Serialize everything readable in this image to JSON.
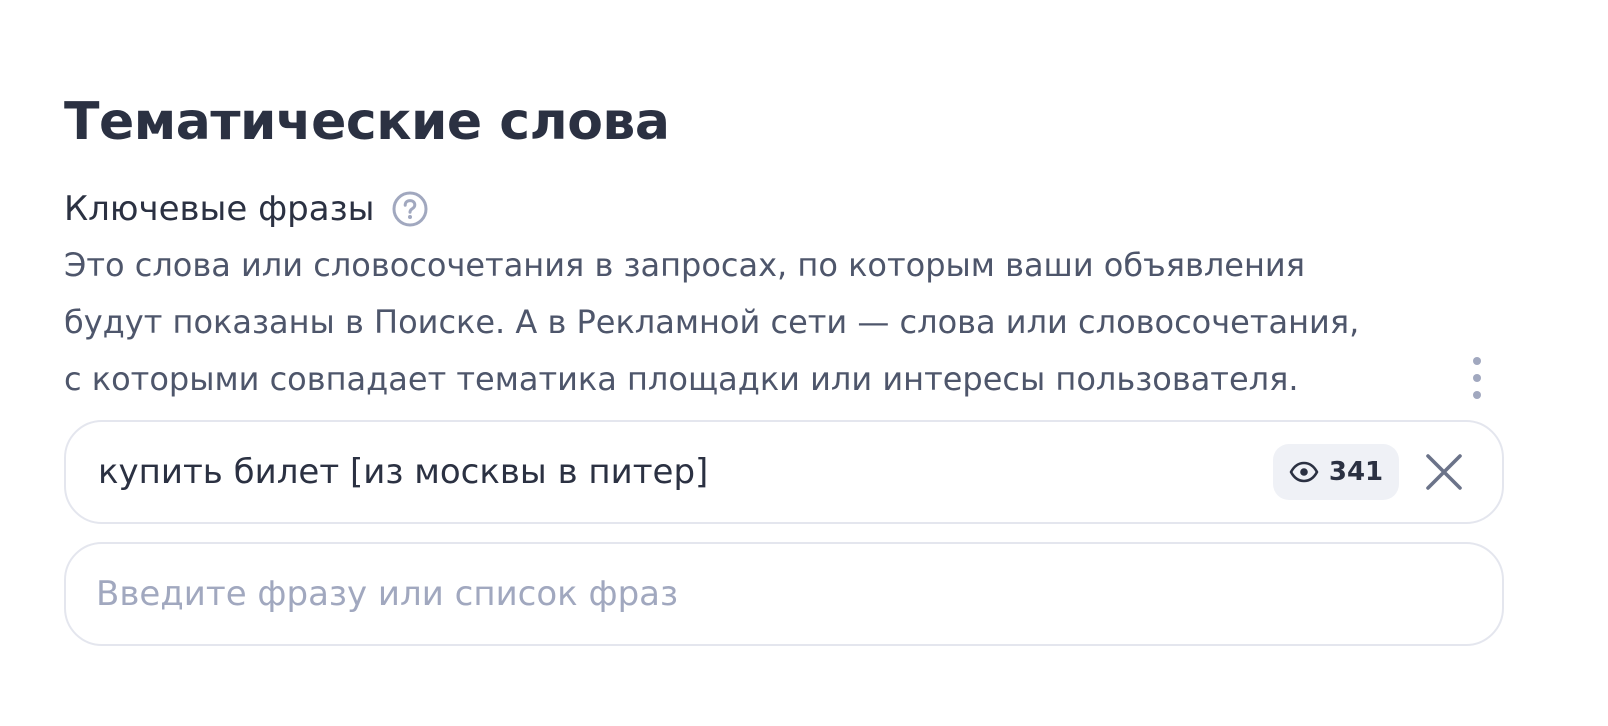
{
  "section": {
    "title": "Тематические слова"
  },
  "keywords": {
    "label": "Ключевые фразы",
    "help_icon": "question-circle-icon",
    "description_lines": [
      "Это слова или словосочетания в запросах, по которым ваши объявления",
      "будут показаны в Поиске. А в Рекламной сети — слова или словосочетания,",
      "с которыми совпадает тематика площадки или интересы пользователя."
    ],
    "more_icon": "more-vertical-icon",
    "phrases": [
      {
        "text": "купить билет [из москвы в питер]",
        "stat_icon": "eye-icon",
        "stat_value": "341",
        "remove_icon": "close-icon"
      }
    ],
    "input": {
      "value": "",
      "placeholder": "Введите фразу или список фраз"
    }
  },
  "colors": {
    "text_primary": "#2b3142",
    "text_secondary": "#4e566b",
    "icon_muted": "#a1a8bf",
    "border": "#e4e6ee",
    "badge_bg": "#eff1f6"
  }
}
